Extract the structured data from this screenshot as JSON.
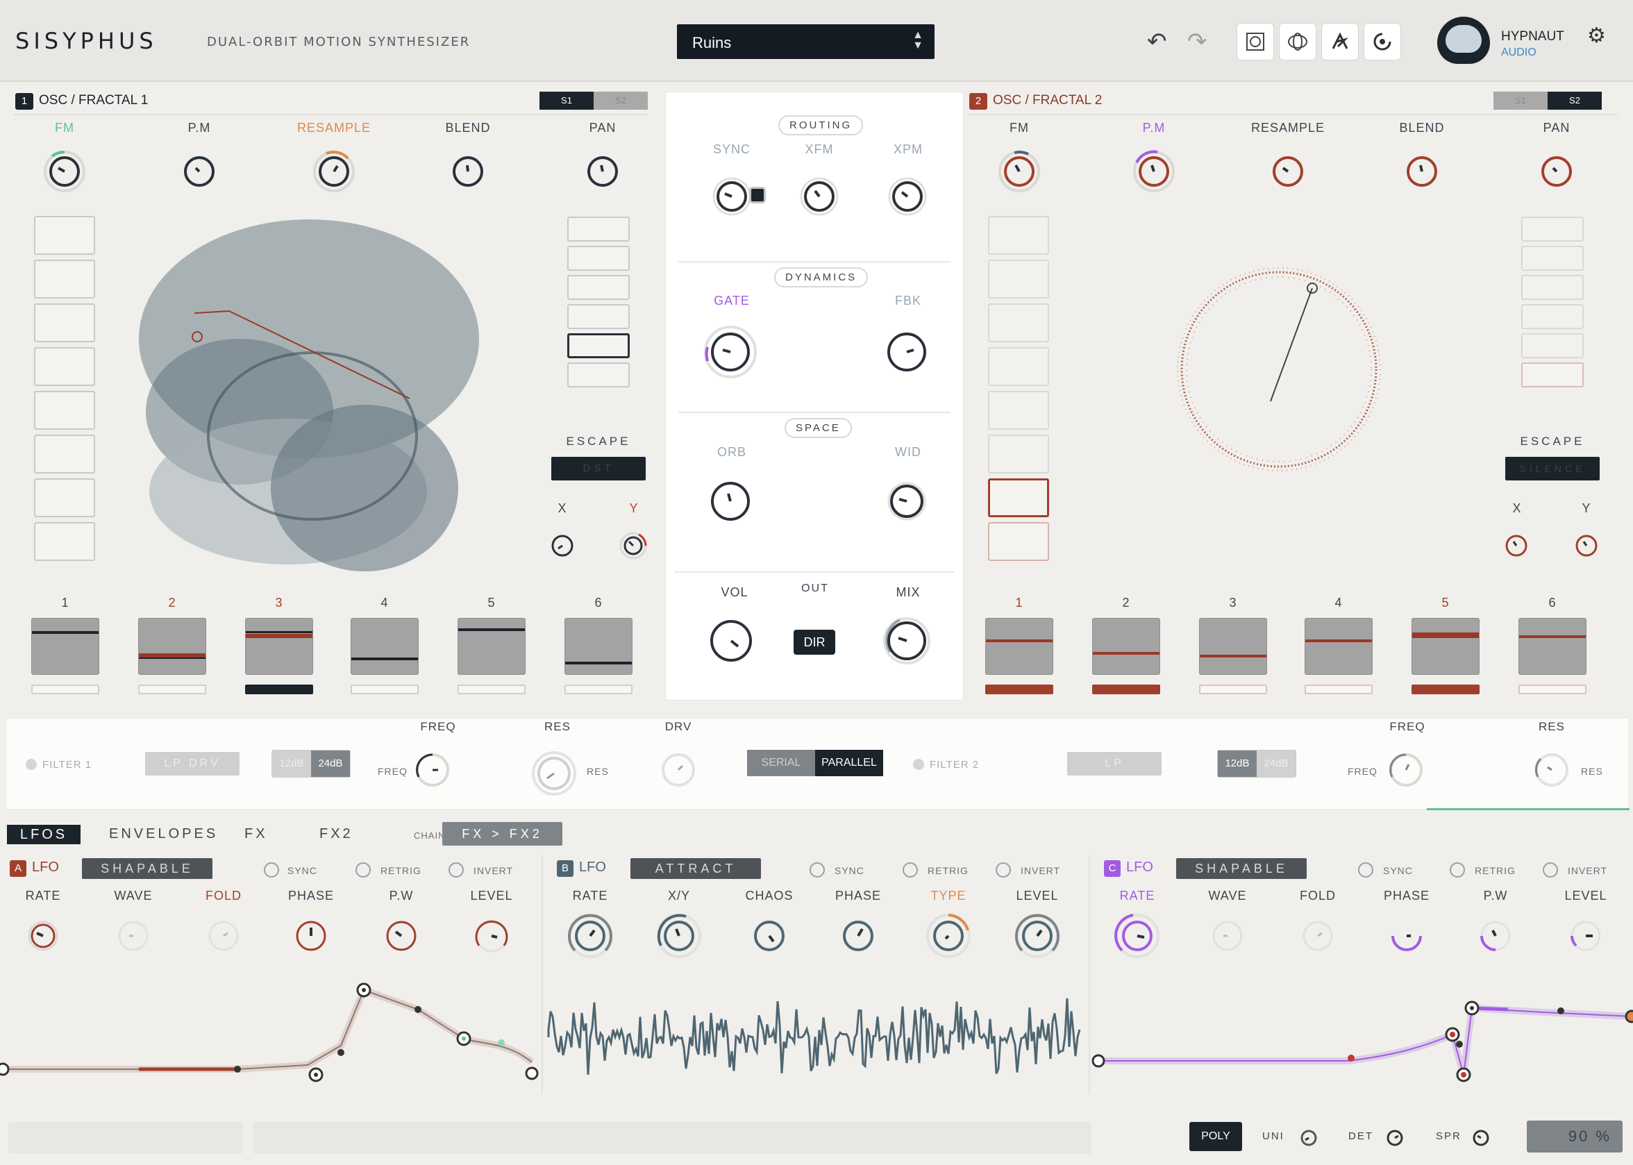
{
  "header": {
    "brand": "SISYPHUS",
    "tagline": "DUAL-ORBIT MOTION SYNTHESIZER",
    "preset": "Ruins",
    "company": "HYPNAUT",
    "company_sub": "AUDIO"
  },
  "colors": {
    "dark": "#141b23",
    "rust": "#a0402c",
    "green": "#5fbf9a",
    "orange": "#e0894a",
    "purple": "#a35be0",
    "slate": "#4f6672"
  },
  "osc1": {
    "badge": "1",
    "title": "OSC / FRACTAL 1",
    "s1": "S1",
    "s2": "S2",
    "knobs": [
      "FM",
      "P.M",
      "RESAMPLE",
      "BLEND",
      "PAN"
    ],
    "escape_label": "ESCAPE",
    "escape_value": "DST",
    "x": "X",
    "y": "Y",
    "slots": [
      "1",
      "2",
      "3",
      "4",
      "5",
      "6"
    ]
  },
  "osc2": {
    "badge": "2",
    "title": "OSC / FRACTAL 2",
    "s1": "S1",
    "s2": "S2",
    "knobs": [
      "FM",
      "P.M",
      "RESAMPLE",
      "BLEND",
      "PAN"
    ],
    "escape_label": "ESCAPE",
    "escape_value": "SILENCE",
    "x": "X",
    "y": "Y",
    "slots": [
      "1",
      "2",
      "3",
      "4",
      "5",
      "6"
    ]
  },
  "center": {
    "routing": "ROUTING",
    "sync": "SYNC",
    "xfm": "XFM",
    "xpm": "XPM",
    "dynamics": "DYNAMICS",
    "gate": "GATE",
    "fbk": "FBK",
    "space": "SPACE",
    "orb": "ORB",
    "wid": "WID",
    "vol": "VOL",
    "out": "OUT",
    "dir": "DIR",
    "mix": "MIX"
  },
  "filter": {
    "filter1": "FILTER 1",
    "type1": "LP DRV",
    "slope_a": "12dB",
    "slope_b": "24dB",
    "freq": "FREQ",
    "res": "RES",
    "drv": "DRV",
    "serial": "SERIAL",
    "parallel": "PARALLEL",
    "filter2": "FILTER 2",
    "type2": "LP"
  },
  "mod": {
    "tabs": [
      "LFOS",
      "ENVELOPES",
      "FX",
      "FX2"
    ],
    "chain_label": "CHAIN",
    "chain_value": "FX > FX2",
    "sync": "SYNC",
    "retrig": "RETRIG",
    "invert": "INVERT",
    "lfoA": {
      "badge": "A",
      "name": "LFO",
      "mode": "SHAPABLE",
      "knobs": [
        "RATE",
        "WAVE",
        "FOLD",
        "PHASE",
        "P.W",
        "LEVEL"
      ]
    },
    "lfoB": {
      "badge": "B",
      "name": "LFO",
      "mode": "ATTRACT",
      "knobs": [
        "RATE",
        "X/Y",
        "CHAOS",
        "PHASE",
        "TYPE",
        "LEVEL"
      ]
    },
    "lfoC": {
      "badge": "C",
      "name": "LFO",
      "mode": "SHAPABLE",
      "knobs": [
        "RATE",
        "WAVE",
        "FOLD",
        "PHASE",
        "P.W",
        "LEVEL"
      ]
    }
  },
  "footer": {
    "poly": "POLY",
    "uni": "UNI",
    "det": "DET",
    "spr": "SPR",
    "zoom": "90 %"
  }
}
